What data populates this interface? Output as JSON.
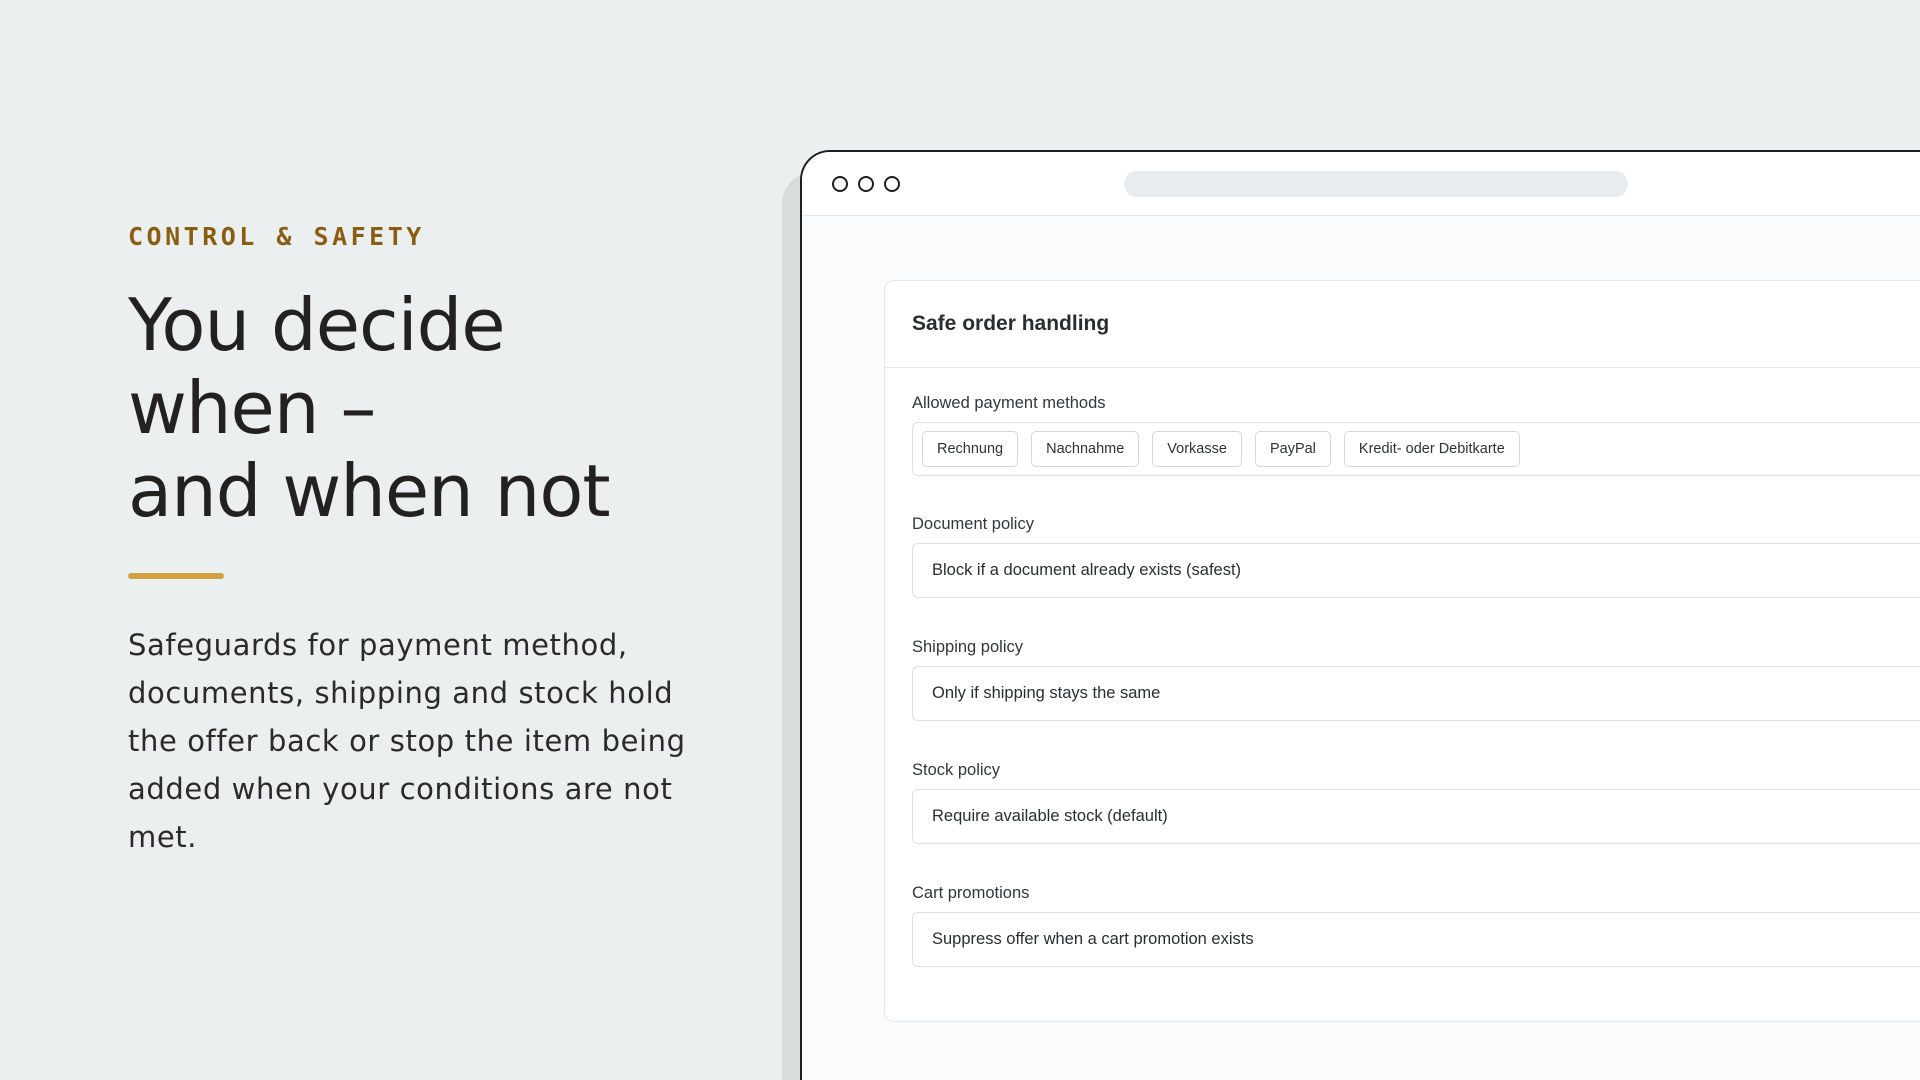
{
  "hero": {
    "eyebrow": "CONTROL & SAFETY",
    "headline_lines": [
      "You decide",
      "when –",
      "and when not"
    ],
    "description": "Safeguards for payment method, documents, shipping and stock hold the offer back or stop the item being added when your conditions are not met.",
    "accent_color": "#d3a13b",
    "eyebrow_color": "#8a5e12"
  },
  "browser": {
    "window_controls": [
      "close",
      "minimize",
      "maximize"
    ]
  },
  "card": {
    "title": "Safe order handling",
    "payment_methods": {
      "label": "Allowed payment methods",
      "chips": [
        "Rechnung",
        "Nachnahme",
        "Vorkasse",
        "PayPal",
        "Kredit- oder Debitkarte"
      ]
    },
    "document_policy": {
      "label": "Document policy",
      "value": "Block if a document already exists (safest)"
    },
    "shipping_policy": {
      "label": "Shipping policy",
      "value": "Only if shipping stays the same"
    },
    "stock_policy": {
      "label": "Stock policy",
      "value": "Require available stock (default)"
    },
    "cart_promotions": {
      "label": "Cart promotions",
      "value": "Suppress offer when a cart promotion exists"
    }
  }
}
